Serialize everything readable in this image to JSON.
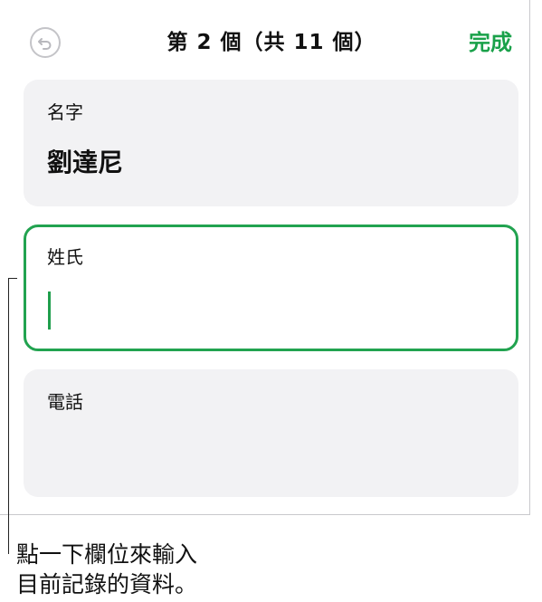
{
  "nav": {
    "title": "第 2 個（共 11 個）",
    "done_label": "完成"
  },
  "fields": [
    {
      "label": "名字",
      "value": "劉達尼"
    },
    {
      "label": "姓氏",
      "value": ""
    },
    {
      "label": "電話",
      "value": ""
    }
  ],
  "callout": {
    "line1": "點一下欄位來輸入",
    "line2": "目前記錄的資料。"
  },
  "colors": {
    "accent": "#1aa14a",
    "field_bg": "#f2f2f4",
    "active_border": "#22a350"
  }
}
